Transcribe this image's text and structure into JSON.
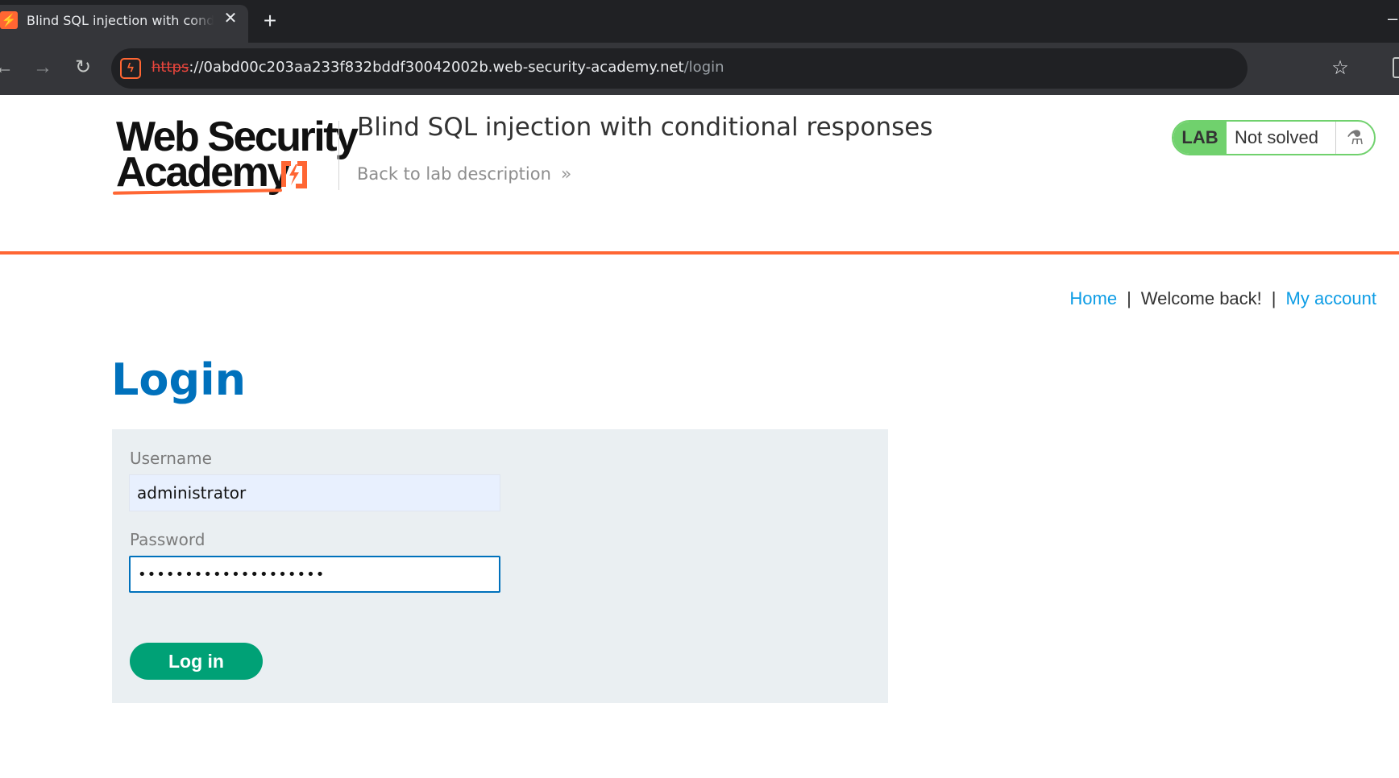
{
  "browser": {
    "tab_title": "Blind SQL injection with conditional responses",
    "tab_favicon": "⚡",
    "tab_close": "✕",
    "new_tab": "+",
    "url_scheme": "https",
    "url_host": "://0abd00c203aa233f832bddf30042002b.web-security-academy.net",
    "url_path": "/login",
    "icons": {
      "back": "back-arrow-icon",
      "forward": "forward-arrow-icon",
      "reload": "reload-icon",
      "bookmark": "star-icon"
    }
  },
  "header": {
    "logo_line1": "Web Security",
    "logo_line2": "Academy",
    "lab_title": "Blind SQL injection with conditional responses",
    "back_link": "Back to lab description",
    "back_chevron": "»",
    "lab_tag": "LAB",
    "lab_status": "Not solved",
    "lab_flask": "⚗"
  },
  "nav": {
    "home": "Home",
    "sep1": "|",
    "welcome": "Welcome back!",
    "sep2": "|",
    "my_account": "My account"
  },
  "login": {
    "heading": "Login",
    "username_label": "Username",
    "username_value": "administrator",
    "password_label": "Password",
    "password_value": "••••••••••••••••••••",
    "button": "Log in"
  },
  "colors": {
    "accent_orange": "#ff6633",
    "heading_blue": "#0071bc",
    "link_blue": "#0e9de5",
    "lab_green": "#70d16d",
    "button_green": "#00a176",
    "panel_bg": "#eaeff2"
  }
}
